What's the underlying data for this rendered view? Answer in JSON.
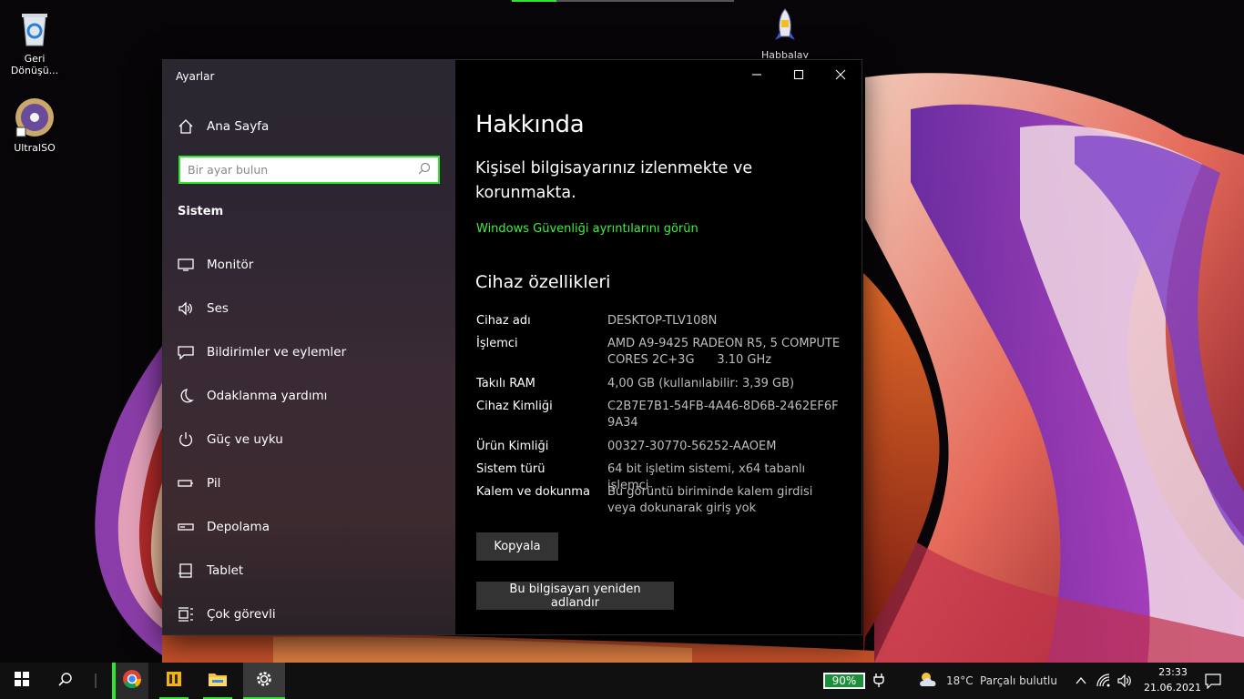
{
  "desktop": {
    "icons": [
      {
        "label": "Geri\nDönüşü...",
        "icon": "recycle-bin-icon"
      },
      {
        "label": "UltraISO",
        "icon": "ultraiso-disc-icon"
      },
      {
        "label": "Habbalay",
        "icon": "rocket-icon"
      }
    ]
  },
  "settings": {
    "app_title": "Ayarlar",
    "home_label": "Ana Sayfa",
    "search_placeholder": "Bir ayar bulun",
    "section_label": "Sistem",
    "nav_items": [
      {
        "label": "Monitör",
        "icon": "monitor-icon"
      },
      {
        "label": "Ses",
        "icon": "speaker-icon"
      },
      {
        "label": "Bildirimler ve eylemler",
        "icon": "notification-icon"
      },
      {
        "label": "Odaklanma yardımı",
        "icon": "moon-icon"
      },
      {
        "label": "Güç ve uyku",
        "icon": "power-icon"
      },
      {
        "label": "Pil",
        "icon": "battery-icon"
      },
      {
        "label": "Depolama",
        "icon": "storage-icon"
      },
      {
        "label": "Tablet",
        "icon": "tablet-icon"
      },
      {
        "label": "Çok görevli",
        "icon": "multitask-icon"
      }
    ],
    "content": {
      "title": "Hakkında",
      "protection_text": "Kişisel bilgisayarınız izlenmekte ve korunmakta.",
      "security_link": "Windows Güvenliği ayrıntılarını görün",
      "specs_title": "Cihaz özellikleri",
      "specs": [
        {
          "key": "Cihaz adı",
          "value": "DESKTOP-TLV108N"
        },
        {
          "key": "İşlemci",
          "value": "AMD A9-9425 RADEON R5, 5 COMPUTE CORES 2C+3G      3.10 GHz"
        },
        {
          "key": "Takılı RAM",
          "value": "4,00 GB (kullanılabilir: 3,39 GB)"
        },
        {
          "key": "Cihaz Kimliği",
          "value": "C2B7E7B1-54FB-4A46-8D6B-2462EF6F9A34"
        },
        {
          "key": "Ürün Kimliği",
          "value": "00327-30770-56252-AAOEM"
        },
        {
          "key": "Sistem türü",
          "value": "64 bit işletim sistemi, x64 tabanlı işlemci"
        },
        {
          "key": "Kalem ve dokunma",
          "value": "Bu görüntü biriminde kalem girdisi veya dokunarak giriş yok"
        }
      ],
      "copy_button": "Kopyala",
      "rename_button": "Bu bilgisayarı yeniden adlandır"
    }
  },
  "taskbar": {
    "battery_percent": "90%",
    "weather_temp": "18°C",
    "weather_text": "Parçalı bulutlu",
    "time": "23:33",
    "date": "21.06.2021"
  },
  "colors": {
    "accent_green": "#2ee62e",
    "link_green": "#3ff13f",
    "battery_fill": "#1b8f3a"
  }
}
